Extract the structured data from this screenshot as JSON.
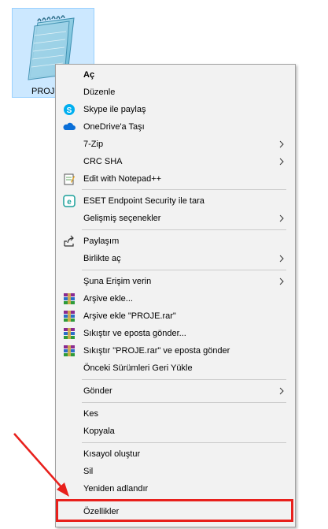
{
  "desktop_file": {
    "label": "PROJE",
    "icon": "notepad-file-icon"
  },
  "context_menu": {
    "items": [
      {
        "label": "Aç",
        "bold": true
      },
      {
        "label": "Düzenle"
      },
      {
        "label": "Skype ile paylaş",
        "icon": "skype-icon"
      },
      {
        "label": "OneDrive'a Taşı",
        "icon": "onedrive-icon"
      },
      {
        "label": "7-Zip",
        "submenu": true
      },
      {
        "label": "CRC SHA",
        "submenu": true
      },
      {
        "label": "Edit with Notepad++",
        "icon": "notepadpp-icon"
      },
      {
        "label": "ESET Endpoint Security ile tara",
        "icon": "eset-icon"
      },
      {
        "label": "Gelişmiş seçenekler",
        "submenu": true
      },
      {
        "label": "Paylaşım",
        "icon": "share-icon"
      },
      {
        "label": "Birlikte aç",
        "submenu": true
      },
      {
        "label": "Şuna Erişim verin",
        "submenu": true
      },
      {
        "label": "Arşive ekle...",
        "icon": "winrar-icon"
      },
      {
        "label": "Arşive ekle \"PROJE.rar\"",
        "icon": "winrar-icon"
      },
      {
        "label": "Sıkıştır ve eposta gönder...",
        "icon": "winrar-icon"
      },
      {
        "label": "Sıkıştır \"PROJE.rar\" ve eposta gönder",
        "icon": "winrar-icon"
      },
      {
        "label": "Önceki Sürümleri Geri Yükle"
      },
      {
        "label": "Gönder",
        "submenu": true
      },
      {
        "label": "Kes"
      },
      {
        "label": "Kopyala"
      },
      {
        "label": "Kısayol oluştur"
      },
      {
        "label": "Sil"
      },
      {
        "label": "Yeniden adlandır"
      },
      {
        "label": "Özellikler",
        "highlighted": true
      }
    ]
  },
  "annotation": {
    "arrow_color": "#e8201c",
    "highlight_color": "#e8201c",
    "target_item": "Özellikler"
  },
  "colors": {
    "menu_background": "#f2f2f2",
    "selection_background": "#cce8ff"
  }
}
